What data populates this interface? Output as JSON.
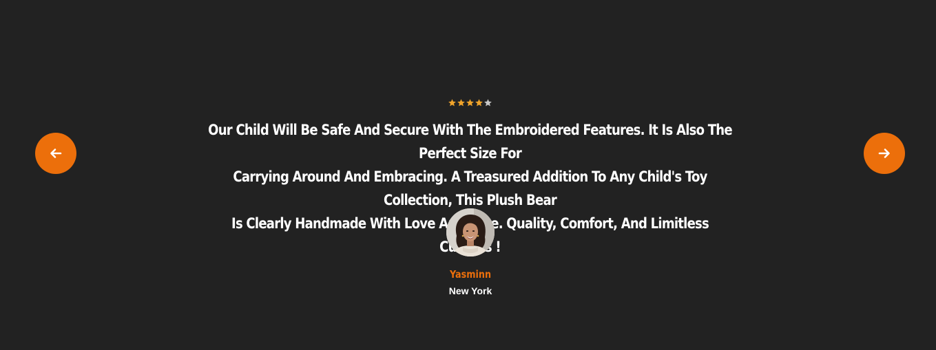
{
  "testimonial": {
    "rating": 4,
    "rating_max": 5,
    "quote_lines": [
      "Our Child Will Be Safe And Secure With The Embroidered Features. It Is Also The Perfect Size For",
      "Carrying Around And Embracing. A Treasured Addition To Any Child's Toy Collection, This Plush Bear",
      "Is Clearly Handmade With Love And Care. Quality, Comfort, And Limitless Cuddles !"
    ],
    "author_name": "Yasminn",
    "author_location": "New York"
  },
  "navigation": {
    "prev_icon": "arrow-left-icon",
    "next_icon": "arrow-right-icon"
  },
  "colors": {
    "background": "#222222",
    "accent": "#ec6f0b",
    "star_filled": "#f0a42b",
    "star_empty": "#c8c8c8",
    "text": "#ffffff"
  }
}
